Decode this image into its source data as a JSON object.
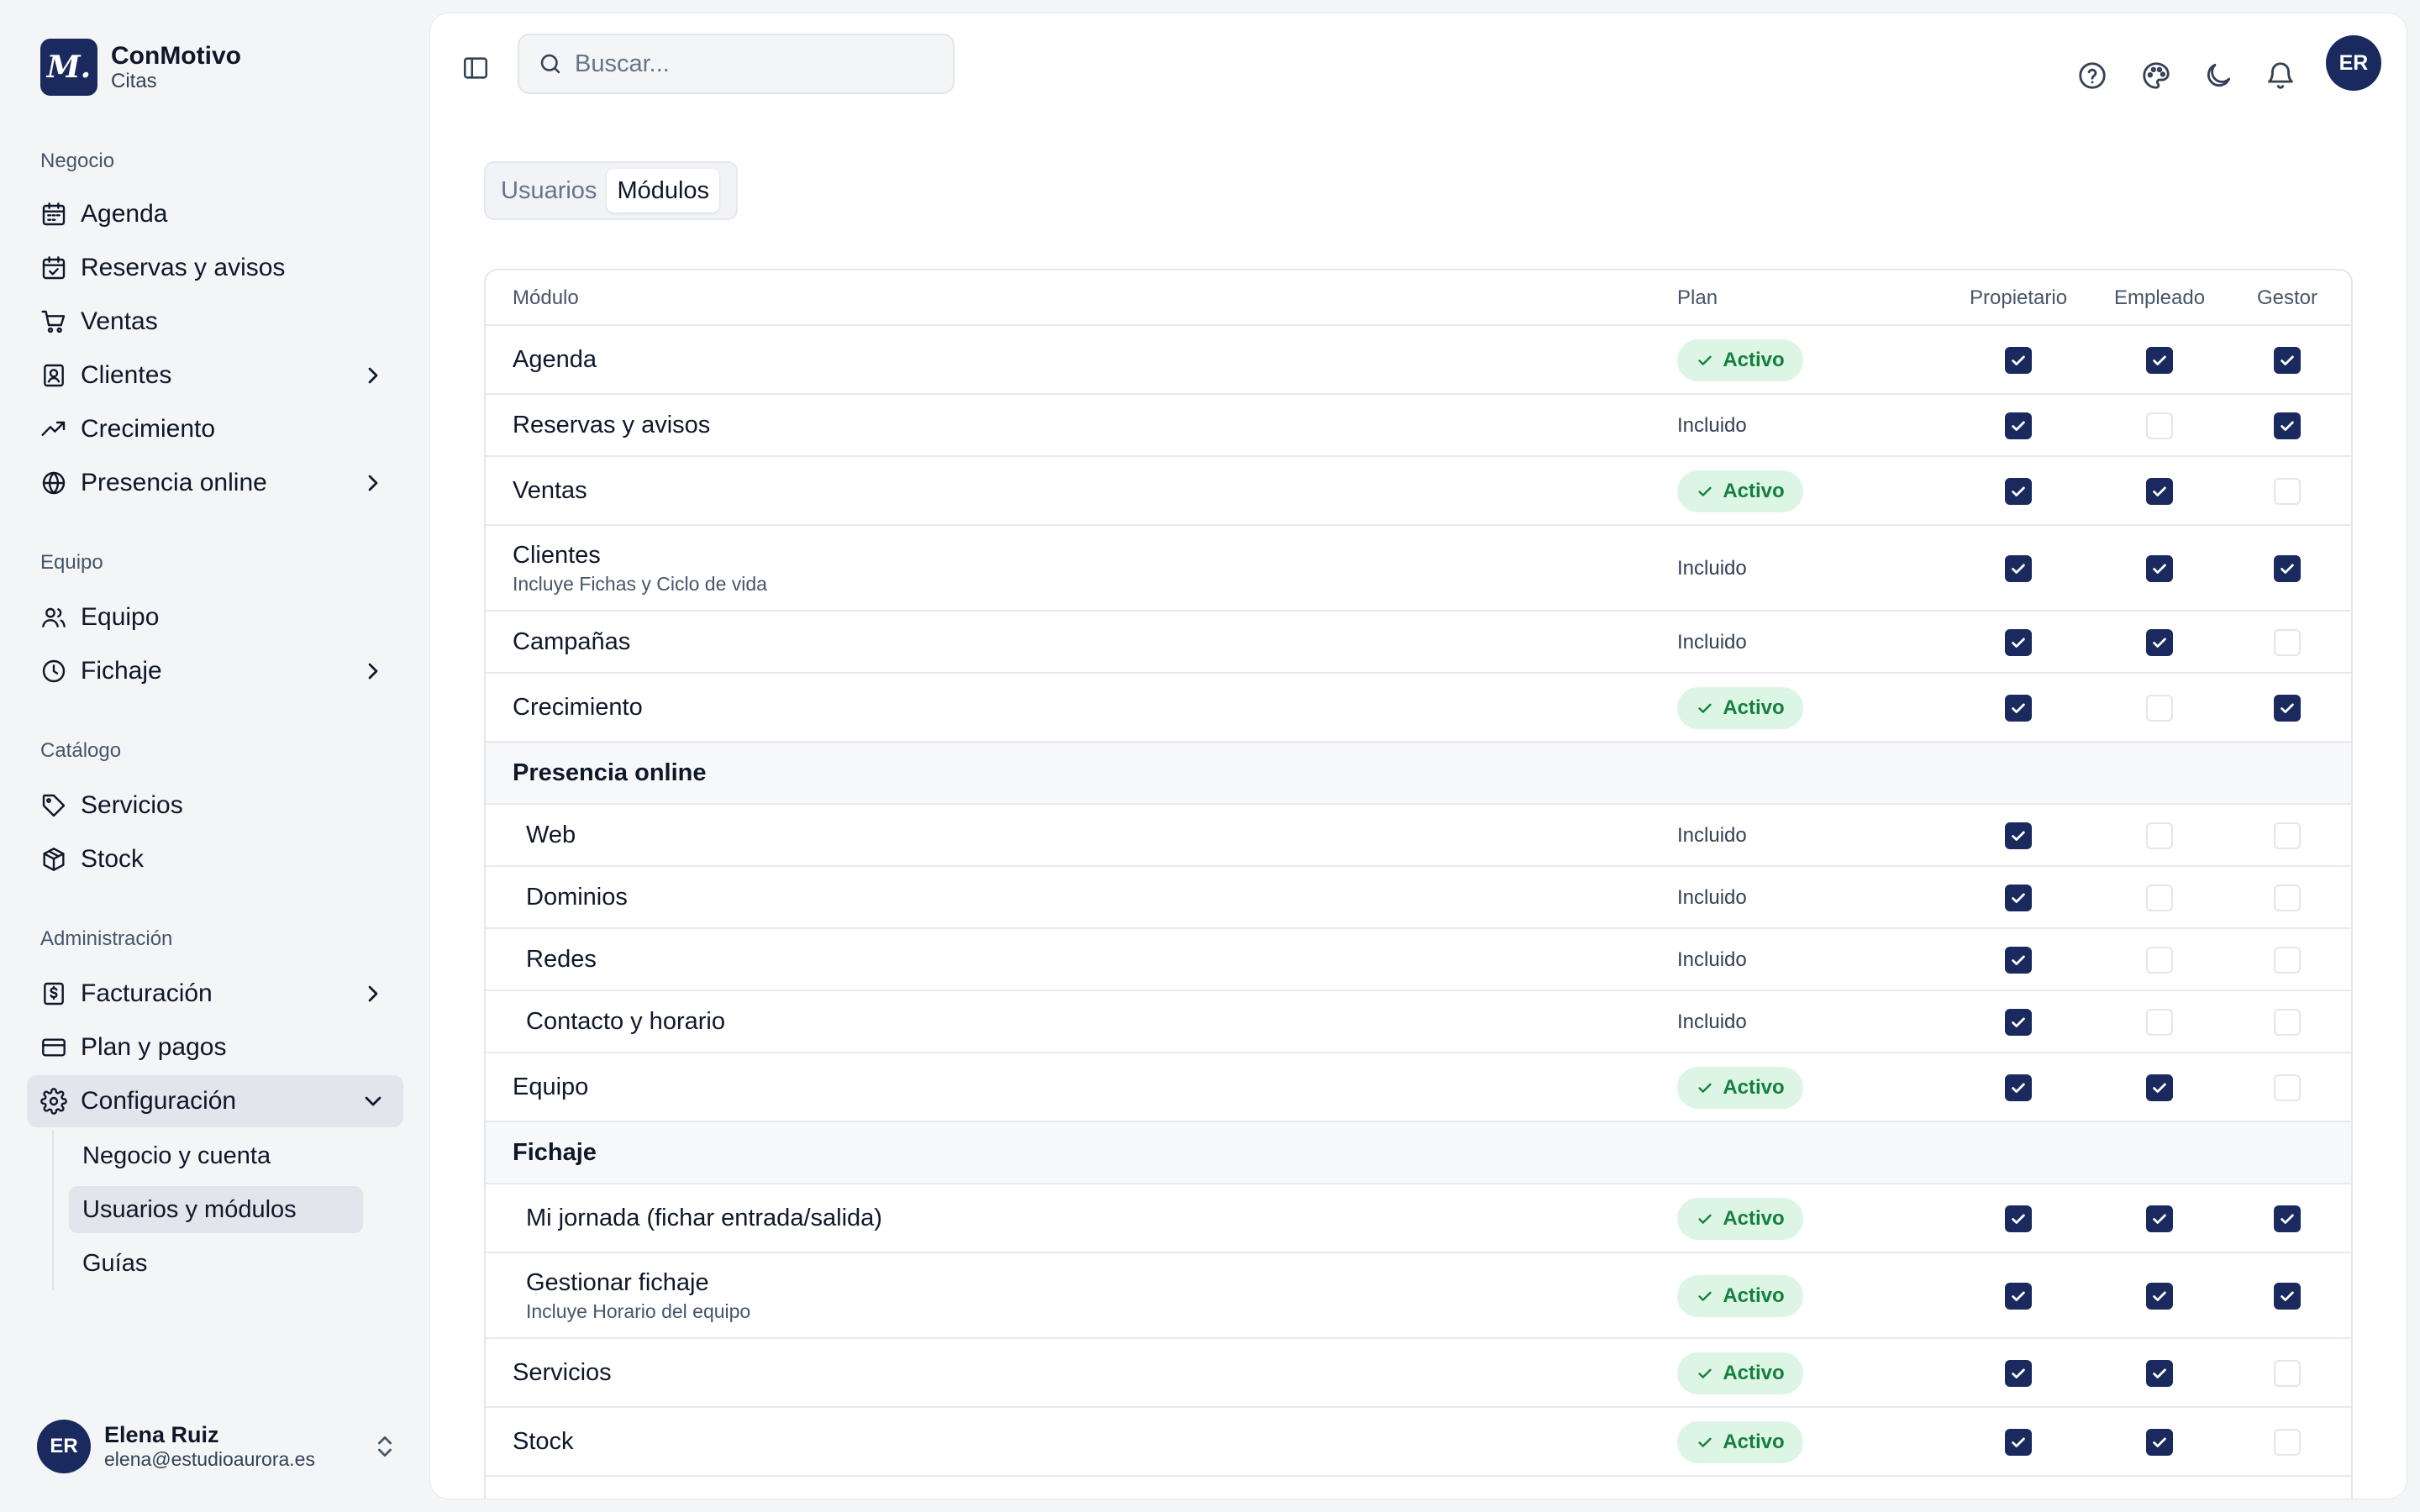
{
  "brand": {
    "logo": "M.",
    "name": "ConMotivo",
    "subtitle": "Citas"
  },
  "sidebar": {
    "sections": {
      "negocio": "Negocio",
      "equipo": "Equipo",
      "catalogo": "Catálogo",
      "administracion": "Administración"
    },
    "items": {
      "agenda": "Agenda",
      "reservas": "Reservas y avisos",
      "ventas": "Ventas",
      "clientes": "Clientes",
      "crecimiento": "Crecimiento",
      "presencia": "Presencia online",
      "equipo": "Equipo",
      "fichaje": "Fichaje",
      "servicios": "Servicios",
      "stock": "Stock",
      "facturacion": "Facturación",
      "plan": "Plan y pagos",
      "configuracion": "Configuración"
    },
    "subitems": {
      "negocio_cuenta": "Negocio y cuenta",
      "usuarios_modulos": "Usuarios y módulos",
      "guias": "Guías"
    }
  },
  "user": {
    "initials": "ER",
    "name": "Elena Ruiz",
    "email": "elena@estudioaurora.es"
  },
  "topbar": {
    "search_placeholder": "Buscar...",
    "avatar_initials": "ER"
  },
  "tabs": {
    "usuarios": "Usuarios",
    "modulos": "Módulos"
  },
  "table": {
    "headers": {
      "modulo": "Módulo",
      "plan": "Plan",
      "propietario": "Propietario",
      "empleado": "Empleado",
      "gestor": "Gestor"
    },
    "badge_active": "Activo",
    "included": "Incluido",
    "rows": [
      {
        "name": "Agenda",
        "sub": "",
        "plan": "active",
        "owner": true,
        "employee": true,
        "manager": true
      },
      {
        "name": "Reservas y avisos",
        "sub": "",
        "plan": "included",
        "owner": true,
        "employee": false,
        "manager": true
      },
      {
        "name": "Ventas",
        "sub": "",
        "plan": "active",
        "owner": true,
        "employee": true,
        "manager": false
      },
      {
        "name": "Clientes",
        "sub": "Incluye Fichas y Ciclo de vida",
        "plan": "included",
        "owner": true,
        "employee": true,
        "manager": true
      },
      {
        "name": "Campañas",
        "sub": "",
        "plan": "included",
        "owner": true,
        "employee": true,
        "manager": false
      },
      {
        "name": "Crecimiento",
        "sub": "",
        "plan": "active",
        "owner": true,
        "employee": false,
        "manager": true
      },
      {
        "name": "Presencia online",
        "group": true
      },
      {
        "name": "Web",
        "child": true,
        "plan": "included",
        "owner": true,
        "employee": false,
        "manager": false
      },
      {
        "name": "Dominios",
        "child": true,
        "plan": "included",
        "owner": true,
        "employee": false,
        "manager": false
      },
      {
        "name": "Redes",
        "child": true,
        "plan": "included",
        "owner": true,
        "employee": false,
        "manager": false
      },
      {
        "name": "Contacto y horario",
        "child": true,
        "plan": "included",
        "owner": true,
        "employee": false,
        "manager": false
      },
      {
        "name": "Equipo",
        "sub": "",
        "plan": "active",
        "owner": true,
        "employee": true,
        "manager": false
      },
      {
        "name": "Fichaje",
        "group": true
      },
      {
        "name": "Mi jornada (fichar entrada/salida)",
        "child": true,
        "plan": "active",
        "owner": true,
        "employee": true,
        "manager": true
      },
      {
        "name": "Gestionar fichaje",
        "child": true,
        "sub": "Incluye Horario del equipo",
        "plan": "active",
        "owner": true,
        "employee": true,
        "manager": true
      },
      {
        "name": "Servicios",
        "sub": "",
        "plan": "active",
        "owner": true,
        "employee": true,
        "manager": false
      },
      {
        "name": "Stock",
        "sub": "",
        "plan": "active",
        "owner": true,
        "employee": true,
        "manager": false
      }
    ]
  },
  "colors": {
    "accent": "#1b2a5e",
    "active_bg": "#dcf5e4",
    "active_text": "#15803d"
  }
}
